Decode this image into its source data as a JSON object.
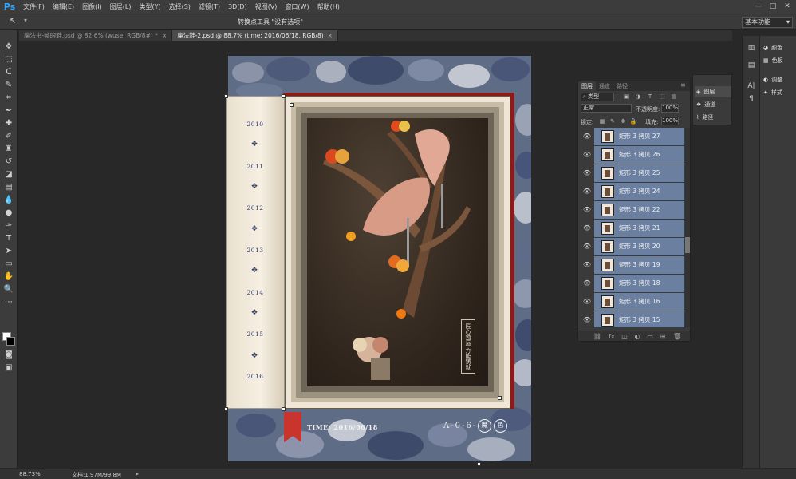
{
  "app": {
    "logo": "Ps"
  },
  "menu": [
    "文件(F)",
    "编辑(E)",
    "图像(I)",
    "图层(L)",
    "类型(Y)",
    "选择(S)",
    "滤镜(T)",
    "3D(D)",
    "视图(V)",
    "窗口(W)",
    "帮助(H)"
  ],
  "window_controls": {
    "minimize": "—",
    "maximize": "□",
    "close": "✕"
  },
  "options_bar": {
    "message": "转换点工具 \"没有选项\"",
    "workspace": "基本功能"
  },
  "tabs": [
    {
      "label": "魔法书-嘘眼鞋.psd @ 82.6% (wuse, RGB/8#) *",
      "close": "×"
    },
    {
      "label": "魔法鞋-2.psd @ 88.7% (time: 2016/06/18, RGB/8)",
      "close": "×"
    }
  ],
  "document": {
    "years": [
      "2010",
      "2011",
      "2012",
      "2013",
      "2014",
      "2015",
      "2016"
    ],
    "time_label": "TIME: 2016/06/18",
    "code_label": "A-0-6-",
    "seal_left": "魔",
    "seal_right": "色",
    "vertical_text": "匠心独运 方能铸就"
  },
  "layers_panel": {
    "tabs": [
      "图层",
      "通道",
      "路径"
    ],
    "menu": "≡",
    "filter": "类型",
    "blend_mode": "正常",
    "opacity_label": "不透明度:",
    "opacity": "100%",
    "lock_label": "锁定:",
    "fill_label": "填充:",
    "fill": "100%",
    "layers": [
      "矩形 3 拷贝 27",
      "矩形 3 拷贝 26",
      "矩形 3 拷贝 25",
      "矩形 3 拷贝 24",
      "矩形 3 拷贝 22",
      "矩形 3 拷贝 21",
      "矩形 3 拷贝 20",
      "矩形 3 拷贝 19",
      "矩形 3 拷贝 18",
      "矩形 3 拷贝 16",
      "矩形 3 拷贝 15"
    ]
  },
  "mini_panel": {
    "items": [
      "图层",
      "通道",
      "路径"
    ]
  },
  "right_dock": {
    "items": [
      "颜色",
      "色板",
      "调整",
      "样式"
    ]
  },
  "status": {
    "zoom": "88.73%",
    "doc": "文档:1.97M/99.8M",
    "arrow": "▸"
  }
}
